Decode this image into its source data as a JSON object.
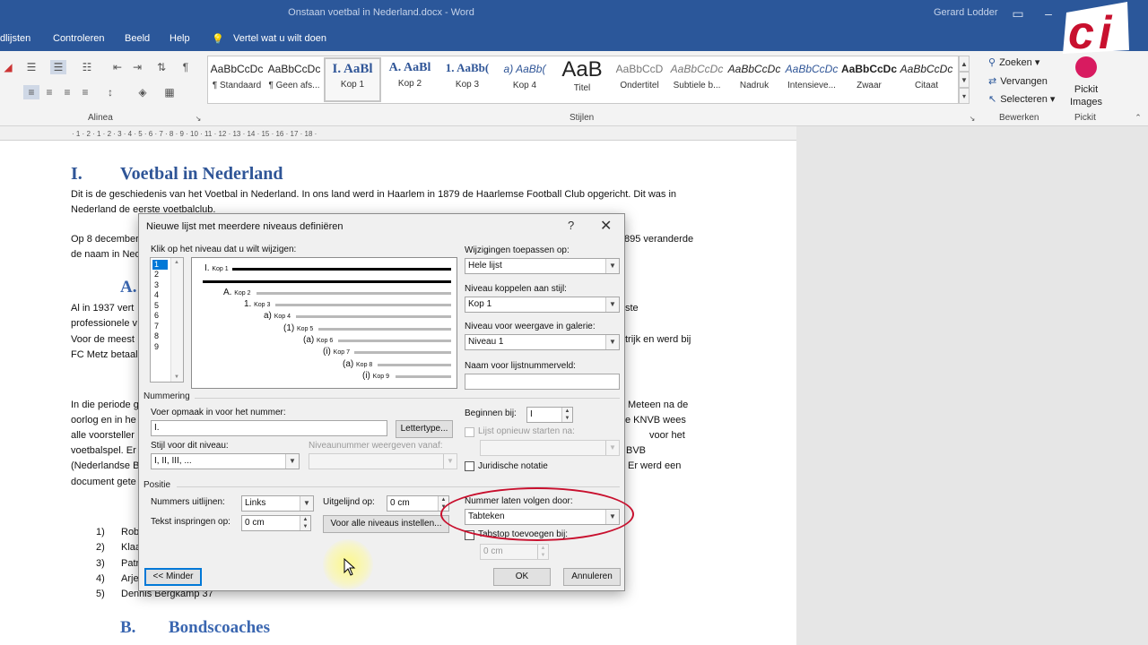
{
  "titlebar": {
    "document_title": "Onstaan voetbal in Nederland.docx - Word",
    "user": "Gerard Lodder"
  },
  "menu": {
    "items": [
      "dlijsten",
      "Controleren",
      "Beeld",
      "Help"
    ],
    "tell_me": "Vertel wat u wilt doen"
  },
  "ribbon": {
    "paragraph_label": "Alinea",
    "styles_label": "Stijlen",
    "edit_label": "Bewerken",
    "pickit_label": "Pickit",
    "styles": [
      {
        "preview": "AaBbCcDc",
        "name": "¶ Standaard"
      },
      {
        "preview": "AaBbCcDc",
        "name": "¶ Geen afs..."
      },
      {
        "preview": "I. AaBl",
        "name": "Kop 1"
      },
      {
        "preview": "A. AaBl",
        "name": "Kop 2"
      },
      {
        "preview": "1. AaBb(",
        "name": "Kop 3"
      },
      {
        "preview": "a) AaBb(",
        "name": "Kop 4"
      },
      {
        "preview": "AaB",
        "name": "Titel"
      },
      {
        "preview": "AaBbCcD",
        "name": "Ondertitel"
      },
      {
        "preview": "AaBbCcDc",
        "name": "Subtiele b..."
      },
      {
        "preview": "AaBbCcDc",
        "name": "Nadruk"
      },
      {
        "preview": "AaBbCcDc",
        "name": "Intensieve..."
      },
      {
        "preview": "AaBbCcDc",
        "name": "Zwaar"
      },
      {
        "preview": "AaBbCcDc",
        "name": "Citaat"
      }
    ],
    "edit": {
      "find": "Zoeken",
      "replace": "Vervangen",
      "select": "Selecteren"
    },
    "pickit": {
      "line1": "Pickit",
      "line2": "Images"
    }
  },
  "ruler": {
    "marks": "· 1 · 2 · 1 · 2 · 3 · 4 · 5 · 6 · 7 · 8 · 9 · 10 · 11 · 12 · 13 · 14 · 15 · 16 · 17 · 18 ·"
  },
  "document": {
    "heading1": {
      "num": "I.",
      "text": "Voetbal in Nederland"
    },
    "para1": "Dit is de geschiedenis van het Voetbal in Nederland. In ons land werd in Haarlem in 1879 de Haarlemse Football Club opgericht. Dit was in Nederland de eerste voetbalclub.",
    "para2_left": " Op 8 december",
    "para2_right": "895 veranderde",
    "para2_line2": "de naam in Ned",
    "heading2a": "A.",
    "para3_l1": "Al in 1937 vert",
    "para3_l2": "professionele v",
    "para3_l3": "Voor de meest",
    "para3_l4": "FC Metz betaal",
    "para3_r1": "ste",
    "para3_r3": "trijk en werd bij",
    "para4_l1": "In die periode g",
    "para4_l2": "oorlog en in he",
    "para4_l3": "alle voorsteller",
    "para4_l4": "voetbalspel. Er",
    "para4_l5": "(Nederlandse B",
    "para4_l6": "document gete",
    "para4_r1": "Meteen na de",
    "para4_r2": "e KNVB wees",
    "para4_r3": "voor het",
    "para4_r4": "BVB",
    "para4_r5": "Er werd een",
    "list": [
      {
        "n": "1)",
        "t": "Rob"
      },
      {
        "n": "2)",
        "t": "Klaa"
      },
      {
        "n": "3)",
        "t": "Patr"
      },
      {
        "n": "4)",
        "t": "Arje"
      },
      {
        "n": "5)",
        "t": "Dennis Bergkamp 37"
      }
    ],
    "heading2b": {
      "num": "B.",
      "text": "Bondscoaches"
    }
  },
  "dialog": {
    "title": "Nieuwe lijst met meerdere niveaus definiëren",
    "help": "?",
    "click_level_label": "Klik op het niveau dat u wilt wijzigen:",
    "levels": [
      "1",
      "2",
      "3",
      "4",
      "5",
      "6",
      "7",
      "8",
      "9"
    ],
    "preview": [
      {
        "num": "I.",
        "name": "Kop 1"
      },
      {
        "num": "A.",
        "name": "Kop 2"
      },
      {
        "num": "1.",
        "name": "Kop 3"
      },
      {
        "num": "a)",
        "name": "Kop 4"
      },
      {
        "num": "(1)",
        "name": "Kop 5"
      },
      {
        "num": "(a)",
        "name": "Kop 6"
      },
      {
        "num": "(i)",
        "name": "Kop 7"
      },
      {
        "num": "(a)",
        "name": "Kop 8"
      },
      {
        "num": "(i)",
        "name": "Kop 9"
      }
    ],
    "apply_to_label": "Wijzigingen toepassen op:",
    "apply_to_value": "Hele lijst",
    "link_style_label": "Niveau koppelen aan stijl:",
    "link_style_value": "Kop 1",
    "gallery_level_label": "Niveau voor weergave in galerie:",
    "gallery_level_value": "Niveau 1",
    "listnum_field_label": "Naam voor lijstnummerveld:",
    "listnum_field_value": "",
    "numbering_section": "Nummering",
    "format_label": "Voer opmaak in voor het nummer:",
    "format_value": "I.",
    "font_button": "Lettertype...",
    "style_label": "Stijl voor dit niveau:",
    "style_value": "I, II, III, ...",
    "include_from_label": "Niveaunummer weergeven vanaf:",
    "include_from_value": "",
    "start_at_label": "Beginnen bij:",
    "start_at_value": "I",
    "restart_label": "Lijst opnieuw starten na:",
    "legal_label": "Juridische notatie",
    "position_section": "Positie",
    "align_label": "Nummers uitlijnen:",
    "align_value": "Links",
    "aligned_at_label": "Uitgelijnd op:",
    "aligned_at_value": "0 cm",
    "indent_label": "Tekst inspringen op:",
    "indent_value": "0 cm",
    "set_all_button": "Voor alle niveaus instellen...",
    "follow_label": "Nummer laten volgen door:",
    "follow_value": "Tabteken",
    "tabstop_label": "Tabstop toevoegen bij:",
    "tabstop_value": "0 cm",
    "less_button": "<< Minder",
    "ok_button": "OK",
    "cancel_button": "Annuleren"
  },
  "colors": {
    "word_blue": "#2b579a",
    "heading_blue": "#2f5597",
    "highlight_red": "#c8102e",
    "select_blue": "#0078d7"
  }
}
